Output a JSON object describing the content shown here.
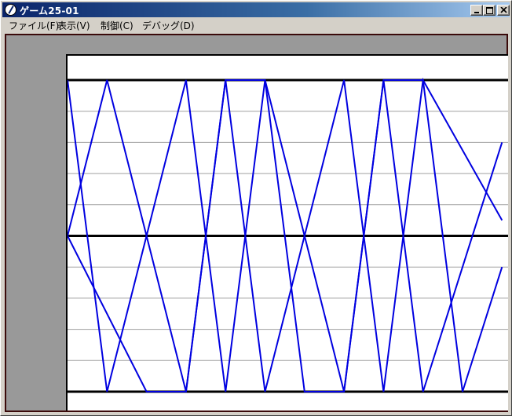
{
  "window": {
    "title": "ゲーム25-01",
    "icon": "app-icon"
  },
  "menu": [
    {
      "label": "ファイル(F)"
    },
    {
      "label": "表示(V)"
    },
    {
      "label": "制御(C)"
    },
    {
      "label": "デバッグ(D)"
    }
  ],
  "colors": {
    "wave": "#0000e0",
    "thick_line": "#000000",
    "thin_line": "#a0a0a0",
    "panel": "#999999"
  },
  "chart_data": {
    "type": "line",
    "title": "",
    "xlabel": "",
    "ylabel": "",
    "ylim": [
      -1,
      1
    ],
    "xlim": [
      0,
      11
    ],
    "thick_y": [
      1,
      0,
      -1
    ],
    "thin_y": [
      0.8,
      0.6,
      0.4,
      0.2,
      -0.2,
      -0.4,
      -0.6,
      -0.8
    ],
    "series": [
      {
        "x": [
          0,
          1,
          3,
          4,
          5,
          7,
          8,
          9,
          11
        ],
        "y": [
          1,
          -1,
          1,
          -1,
          1,
          -1,
          1,
          -1,
          0.6
        ]
      },
      {
        "x": [
          0,
          2,
          3,
          4,
          5,
          6,
          7,
          8,
          9,
          10,
          11
        ],
        "y": [
          0,
          -1,
          -1,
          1,
          1,
          -1,
          -1,
          1,
          1,
          -1,
          -0.2
        ]
      },
      {
        "x": [
          0,
          1,
          3,
          4,
          5,
          7,
          8,
          9,
          11
        ],
        "y": [
          0,
          1,
          -1,
          1,
          -1,
          1,
          -1,
          1,
          0.1
        ]
      }
    ]
  }
}
